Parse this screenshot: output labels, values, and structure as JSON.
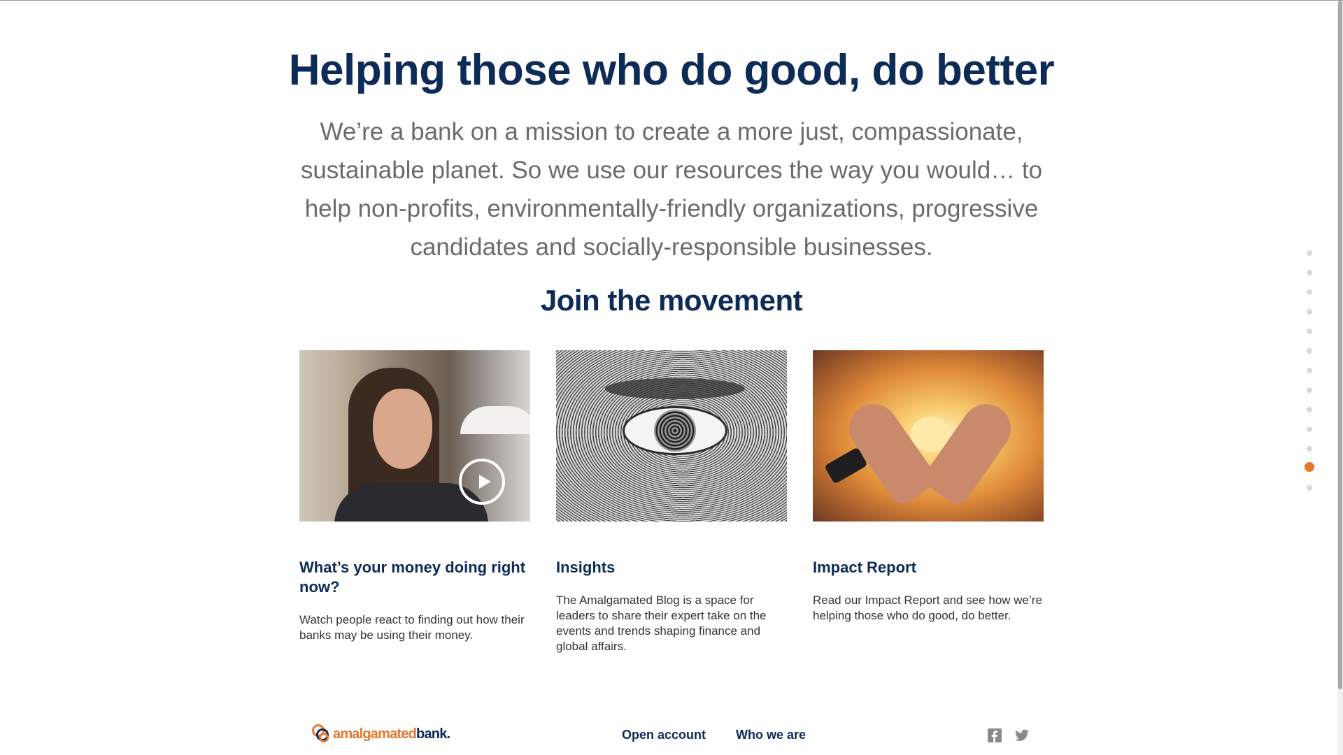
{
  "hero": {
    "headline": "Helping those who do good, do better",
    "mission": "We’re a bank on a mission to create a more just, compassionate, sustainable planet. So we use our resources the way you would… to help non-profits, environmentally-friendly organizations, progressive candidates and socially-responsible businesses.",
    "subhead": "Join the movement"
  },
  "cards": [
    {
      "title": "What’s your money doing right now?",
      "description": "Watch people react to finding out how their banks may be using their money.",
      "image": "woman-video-thumbnail",
      "play_icon": "play-circle-icon"
    },
    {
      "title": "Insights",
      "description": "The Amalgamated Blog is a space for leaders to share their expert take on the events and trends shaping finance and global affairs.",
      "image": "engraved-eye-banknote"
    },
    {
      "title": "Impact Report",
      "description": "Read our Impact Report and see how we’re helping those who do good, do better.",
      "image": "heart-hands"
    }
  ],
  "footer": {
    "logo_text_orange": "amalgamated",
    "logo_text_blue": "bank",
    "logo_dot": ".",
    "links": [
      "Open account",
      "Who we are"
    ],
    "social": [
      "facebook-icon",
      "twitter-icon"
    ]
  },
  "dot_nav": {
    "count": 13,
    "active_index": 11
  },
  "colors": {
    "navy": "#0d2b57",
    "orange": "#e8772e",
    "body_gray": "#6b6b6b"
  }
}
